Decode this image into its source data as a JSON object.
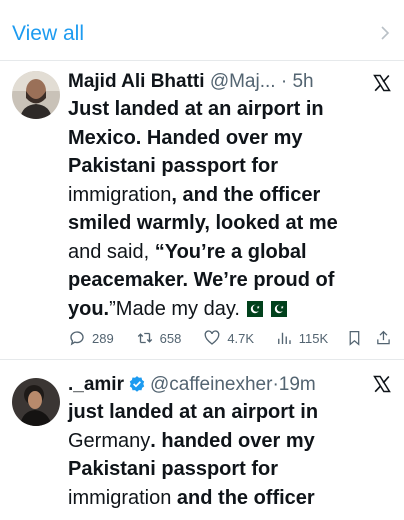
{
  "view_all": {
    "label": "View all"
  },
  "tweets": [
    {
      "name": "Majid Ali Bhatti",
      "handle": "@Maj...",
      "dot": "·",
      "time": "5h",
      "body_plain_1": "Just landed at an airport in",
      "body_plain_2": "Mexico. Handed over my",
      "body_plain_3": "Pakistani passport for",
      "body_plain_4a": "immigration",
      "body_plain_4b": ", and the officer",
      "body_plain_5": "smiled warmly, looked at me",
      "body_plain_6a": "and said, ",
      "body_plain_6b": "“You’re a global",
      "body_plain_7": "peacemaker. We’re proud of",
      "body_plain_8a": "you.",
      "body_plain_8b": "”Made my day.",
      "flags": [
        "pakistan-flag",
        "pakistan-flag"
      ],
      "replies": "289",
      "reposts": "658",
      "likes": "4.7K",
      "views": "115K"
    },
    {
      "name": "._amir",
      "handle": "@caffeinexher",
      "dot": "·",
      "time": "19m",
      "body_1": "just landed at an airport in",
      "body_2a": "Germany",
      "body_2b": ". handed over my",
      "body_3": "Pakistani passport for",
      "body_4a": "immigration",
      "body_4b": " and the officer"
    }
  ],
  "colors": {
    "accent": "#1d9bf0",
    "muted": "#536471",
    "text": "#0f1419",
    "pk_green": "#01411c"
  },
  "icons": [
    "chevron-right-icon",
    "x-logo-icon",
    "reply-icon",
    "repost-icon",
    "like-icon",
    "views-icon",
    "bookmark-icon",
    "share-icon",
    "verified-badge-icon"
  ]
}
